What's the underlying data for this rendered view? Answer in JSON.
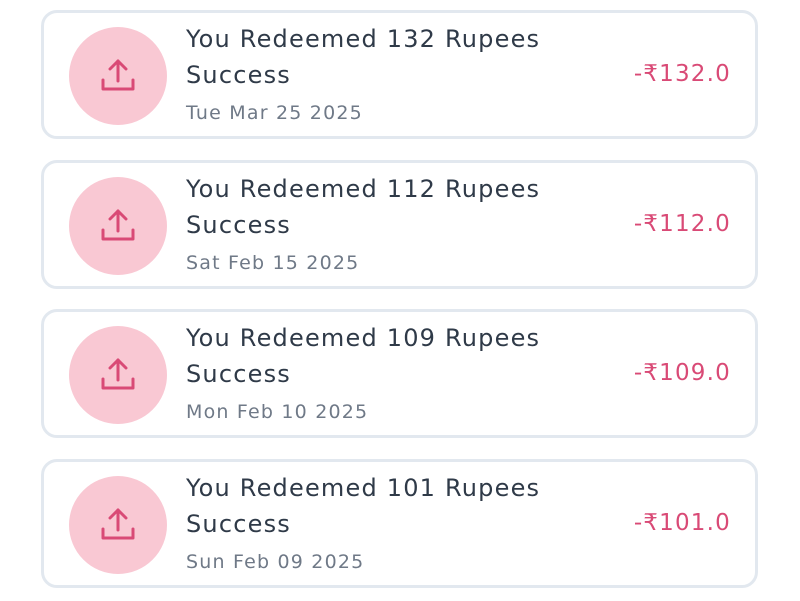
{
  "transactions": [
    {
      "title": "You Redeemed 132 Rupees",
      "status": "Success",
      "date": "Tue Mar 25 2025",
      "amount": "-₹132.0",
      "icon": "upload-icon"
    },
    {
      "title": "You Redeemed 112 Rupees",
      "status": "Success",
      "date": "Sat Feb 15 2025",
      "amount": "-₹112.0",
      "icon": "upload-icon"
    },
    {
      "title": "You Redeemed 109 Rupees",
      "status": "Success",
      "date": "Mon Feb 10 2025",
      "amount": "-₹109.0",
      "icon": "upload-icon"
    },
    {
      "title": "You Redeemed 101 Rupees",
      "status": "Success",
      "date": "Sun Feb 09 2025",
      "amount": "-₹101.0",
      "icon": "upload-icon"
    }
  ],
  "colors": {
    "icon_background": "#f9c8d3",
    "icon_stroke": "#d94a76",
    "amount": "#d94a76",
    "title": "#2f3a48",
    "date": "#6f7987",
    "card_border": "#e2e8ef"
  }
}
